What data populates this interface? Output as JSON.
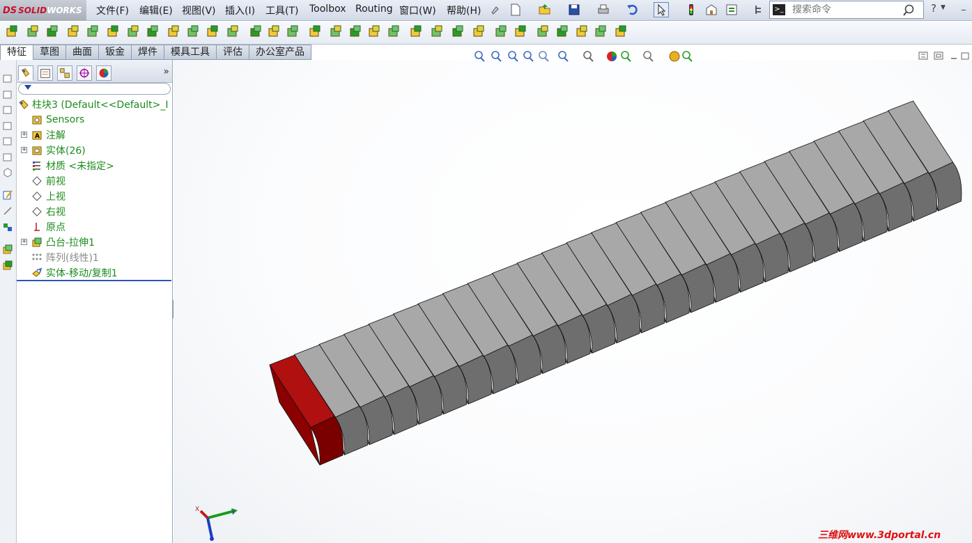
{
  "app": {
    "logo_ds": "DS",
    "logo_solid": "SOLID",
    "logo_works": "WORKS"
  },
  "menu": [
    "文件(F)",
    "编辑(E)",
    "视图(V)",
    "插入(I)",
    "工具(T)",
    "Toolbox",
    "Routing",
    "窗口(W)",
    "帮助(H)"
  ],
  "search": {
    "placeholder": "搜索命令"
  },
  "tabs": [
    "特征",
    "草图",
    "曲面",
    "钣金",
    "焊件",
    "模具工具",
    "评估",
    "办公室产品"
  ],
  "feature_tree": {
    "root": "柱块3  (Default<<Default>_I",
    "items": [
      {
        "label": "Sensors",
        "icon": "sensors-icon"
      },
      {
        "label": "注解",
        "icon": "annotations-icon"
      },
      {
        "label": "实体(26)",
        "icon": "solid-bodies-icon"
      },
      {
        "label": "材质 <未指定>",
        "icon": "material-icon"
      },
      {
        "label": "前视",
        "icon": "plane-icon"
      },
      {
        "label": "上视",
        "icon": "plane-icon"
      },
      {
        "label": "右视",
        "icon": "plane-icon"
      },
      {
        "label": "原点",
        "icon": "origin-icon"
      },
      {
        "label": "凸台-拉伸1",
        "icon": "extrude-icon"
      },
      {
        "label": "阵列(线性)1",
        "icon": "linear-pattern-icon"
      },
      {
        "label": "实体-移动/复制1",
        "icon": "move-copy-body-icon"
      }
    ]
  },
  "model": {
    "block_count": 26,
    "highlight_color": "#8b0000",
    "block_color": "#808080"
  },
  "triad": {
    "x_label": "X",
    "y_label": "Y"
  },
  "watermark": "三维网www.3dportal.cn"
}
